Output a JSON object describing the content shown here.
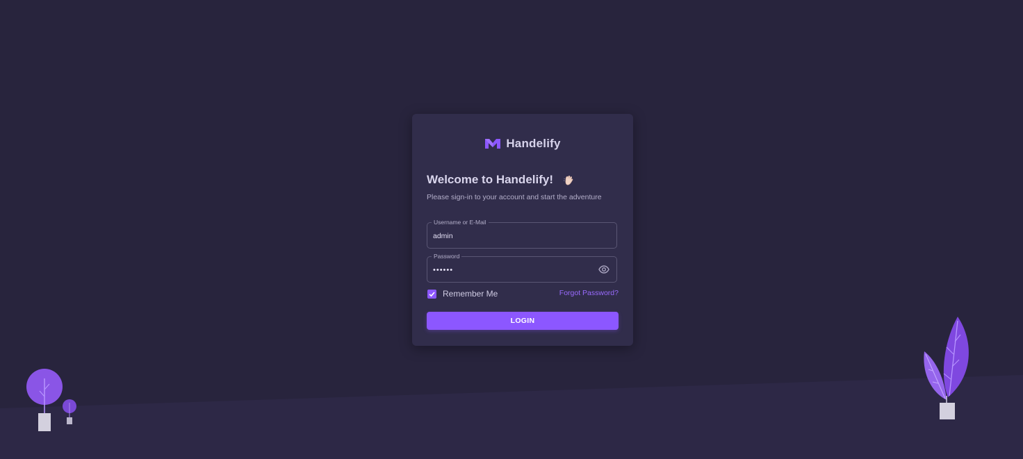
{
  "brand": {
    "name": "Handelify",
    "logo_icon": "m-logo-icon",
    "accent_color": "#8c57ff"
  },
  "login": {
    "title": "Welcome to Handelify!",
    "title_emoji_icon": "waving-hand-icon",
    "subtitle": "Please sign-in to your account and start the adventure",
    "username": {
      "label": "Username or E-Mail",
      "value": "admin"
    },
    "password": {
      "label": "Password",
      "value": "••••••",
      "toggle_icon": "eye-icon"
    },
    "remember_me": {
      "label": "Remember Me",
      "checked": true
    },
    "forgot_password": "Forgot Password?",
    "submit_label": "LOGIN"
  },
  "theme": {
    "background": "#28243d",
    "card_background": "#312d4b",
    "decoration_icons": [
      "tree-icon",
      "small-tree-icon",
      "leaf-plant-icon"
    ]
  }
}
